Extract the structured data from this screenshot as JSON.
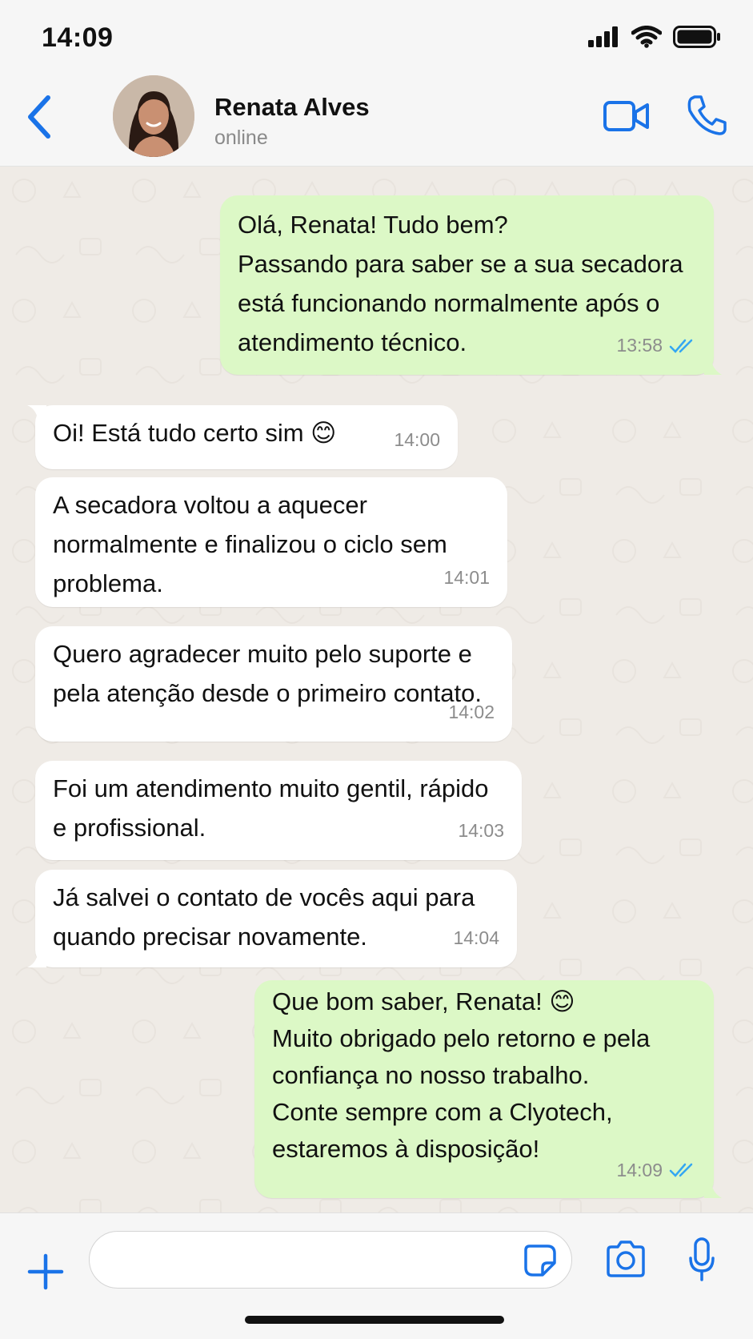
{
  "status_bar": {
    "time": "14:09"
  },
  "header": {
    "contact_name": "Renata Alves",
    "contact_status": "online"
  },
  "messages": [
    {
      "direction": "out",
      "text": "Olá, Renata! Tudo bem?\nPassando para saber se a sua secadora\nestá funcionando normalmente após o\natendimento técnico.",
      "time": "13:58",
      "read": true
    },
    {
      "direction": "in",
      "text": "Oi! Está tudo certo sim 😊",
      "time": "14:00"
    },
    {
      "direction": "in",
      "text": "A secadora voltou a aquecer\nnormalmente e finalizou o ciclo sem\nproblema.",
      "time": "14:01"
    },
    {
      "direction": "in",
      "text": "Quero agradecer muito pelo suporte e\npela atenção desde o primeiro contato.",
      "time": "14:02"
    },
    {
      "direction": "in",
      "text": "Foi um atendimento muito gentil, rápido\ne profissional.",
      "time": "14:03"
    },
    {
      "direction": "in",
      "text": "Já salvei o contato de vocês aqui para\nquando precisar novamente.",
      "time": "14:04"
    },
    {
      "direction": "out",
      "text": "Que bom saber, Renata! 😊\nMuito obrigado pelo retorno e pela\nconfiança no nosso trabalho.\nConte sempre com a Clyotech,\nestaremos à disposição!",
      "time": "14:09",
      "read": true
    }
  ],
  "input": {
    "placeholder": "",
    "value": ""
  },
  "colors": {
    "accent": "#1a73e8",
    "outgoing_bubble": "#dcf8c6",
    "incoming_bubble": "#ffffff",
    "chat_background": "#efebe6",
    "read_ticks": "#34a7f2"
  },
  "icons": [
    "back-chevron-icon",
    "video-call-icon",
    "phone-call-icon",
    "plus-icon",
    "sticker-icon",
    "camera-icon",
    "microphone-icon",
    "double-check-icon",
    "signal-icon",
    "wifi-icon",
    "battery-icon"
  ]
}
